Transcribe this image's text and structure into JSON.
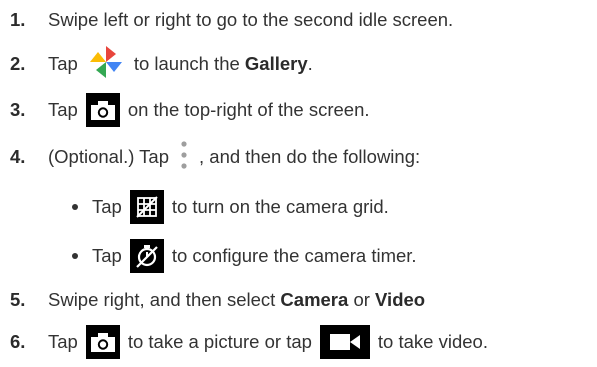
{
  "steps": [
    {
      "num": "1.",
      "text": "Swipe left or right to go to the second idle screen."
    },
    {
      "num": "2.",
      "pre": "Tap",
      "post": "to launch the",
      "bold": "Gallery",
      "end": "."
    },
    {
      "num": "3.",
      "pre": "Tap",
      "post": "on the top-right of the screen."
    },
    {
      "num": "4.",
      "pre": "(Optional.) Tap",
      "post": ", and then do the following:"
    },
    {
      "num": "5.",
      "pre": "Swipe right, and then select",
      "bold1": "Camera",
      "mid": "or",
      "bold2": "Video"
    },
    {
      "num": "6.",
      "pre": "Tap",
      "mid": "to take a picture or tap",
      "post": "to take video."
    }
  ],
  "bullets": [
    {
      "pre": "Tap",
      "post": "to turn on the camera grid."
    },
    {
      "pre": "Tap",
      "post": "to configure the camera timer."
    }
  ],
  "icons": {
    "gallery": "gallery-pinwheel-icon",
    "camera": "camera-icon",
    "menu": "more-vertical-icon",
    "grid": "grid-icon",
    "timer": "timer-icon",
    "video": "video-icon"
  }
}
